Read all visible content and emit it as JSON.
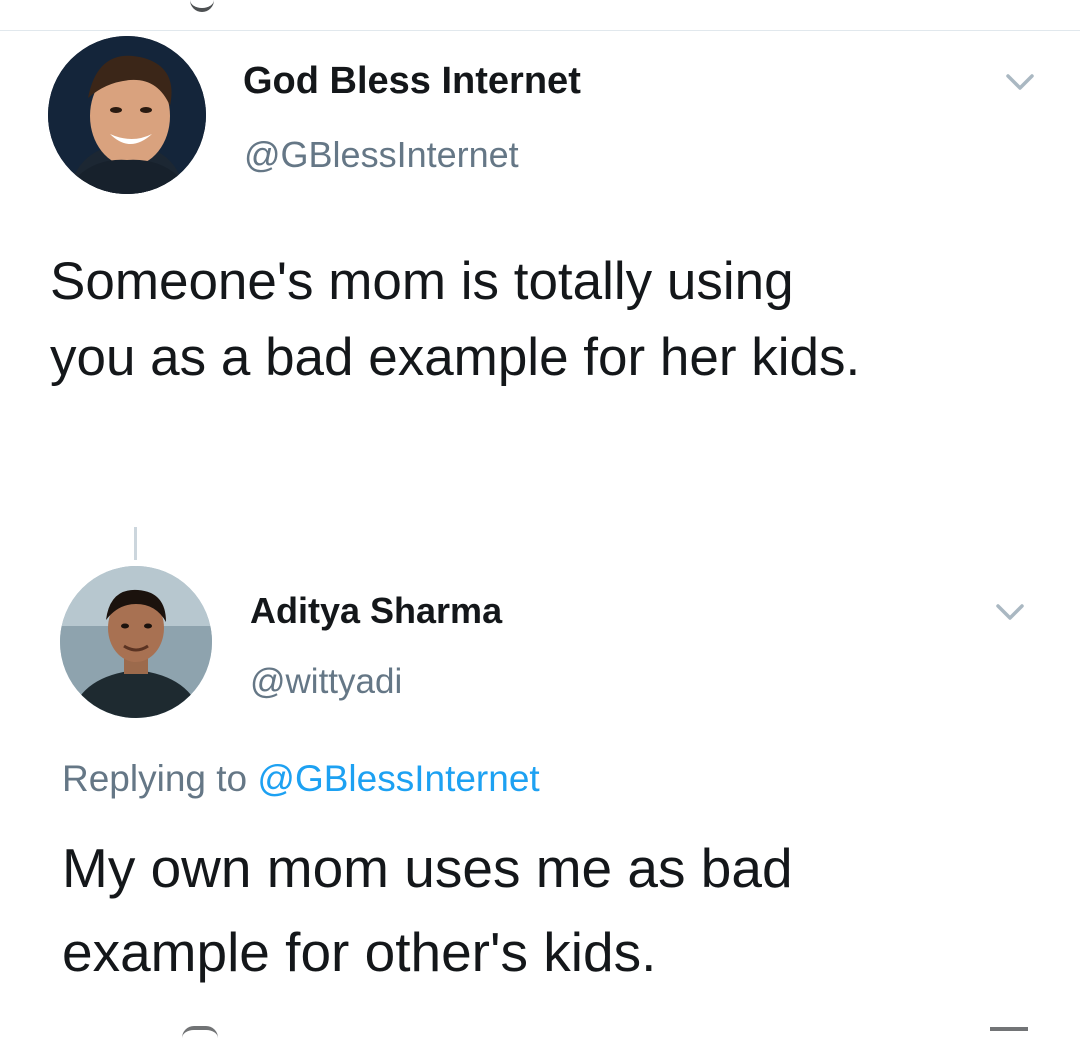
{
  "tweet": {
    "author": {
      "display_name": "God Bless Internet",
      "handle": "@GBlessInternet",
      "avatar_icon": "person-avatar-icon"
    },
    "text_lines": [
      "Someone's mom is totally using",
      "you as a bad example for her kids."
    ],
    "menu_icon": "chevron-down-icon"
  },
  "reply": {
    "author": {
      "display_name": "Aditya Sharma",
      "handle": "@wittyadi",
      "avatar_icon": "person-avatar-icon"
    },
    "replying_prefix": "Replying to",
    "replying_to": "@GBlessInternet",
    "text_lines": [
      "My own mom uses me as bad",
      "example for other's kids."
    ],
    "menu_icon": "chevron-down-icon"
  },
  "colors": {
    "primary_text": "#14171a",
    "secondary_text": "#657786",
    "link": "#1da1f2",
    "divider": "#e1e8ed"
  }
}
